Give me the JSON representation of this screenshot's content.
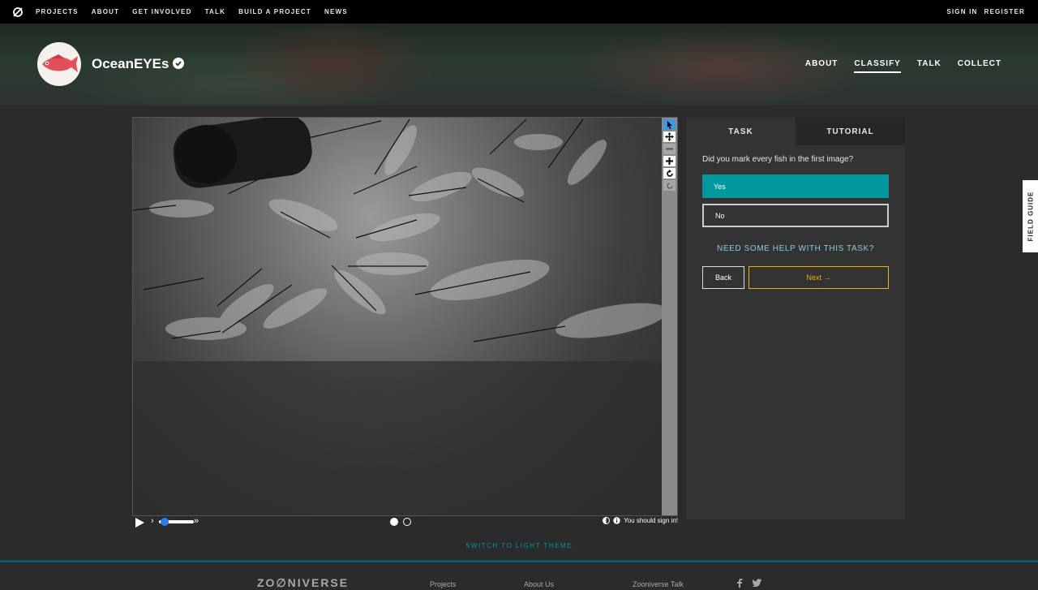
{
  "topnav": {
    "links": [
      "PROJECTS",
      "ABOUT",
      "GET INVOLVED",
      "TALK",
      "BUILD A PROJECT",
      "NEWS"
    ],
    "sign_in": "SIGN IN",
    "register": "REGISTER"
  },
  "project": {
    "title": "OceanEYEs",
    "nav": [
      "ABOUT",
      "CLASSIFY",
      "TALK",
      "COLLECT"
    ],
    "active_nav": "CLASSIFY"
  },
  "viewer": {
    "frames": 2,
    "current_frame": 1,
    "signin_note": "You should sign in!"
  },
  "task": {
    "tabs": [
      "TASK",
      "TUTORIAL"
    ],
    "question": "Did you mark every fish in the first image?",
    "answers": [
      "Yes",
      "No"
    ],
    "selected_answer": "Yes",
    "help": "NEED SOME HELP WITH THIS TASK?",
    "back_label": "Back",
    "next_label": "Next →"
  },
  "field_guide": "FIELD GUIDE",
  "theme_switch": "SWITCH TO LIGHT THEME",
  "footer": {
    "brand": "ZO∅NIVERSE",
    "links": [
      "Projects",
      "About Us",
      "Zooniverse Talk"
    ],
    "social": [
      "facebook-icon",
      "twitter-icon"
    ]
  },
  "colors": {
    "accent_teal": "#00979d",
    "next_gold": "#f0b200",
    "help_text": "#87ced4",
    "tool_active": "#3b97e8"
  }
}
